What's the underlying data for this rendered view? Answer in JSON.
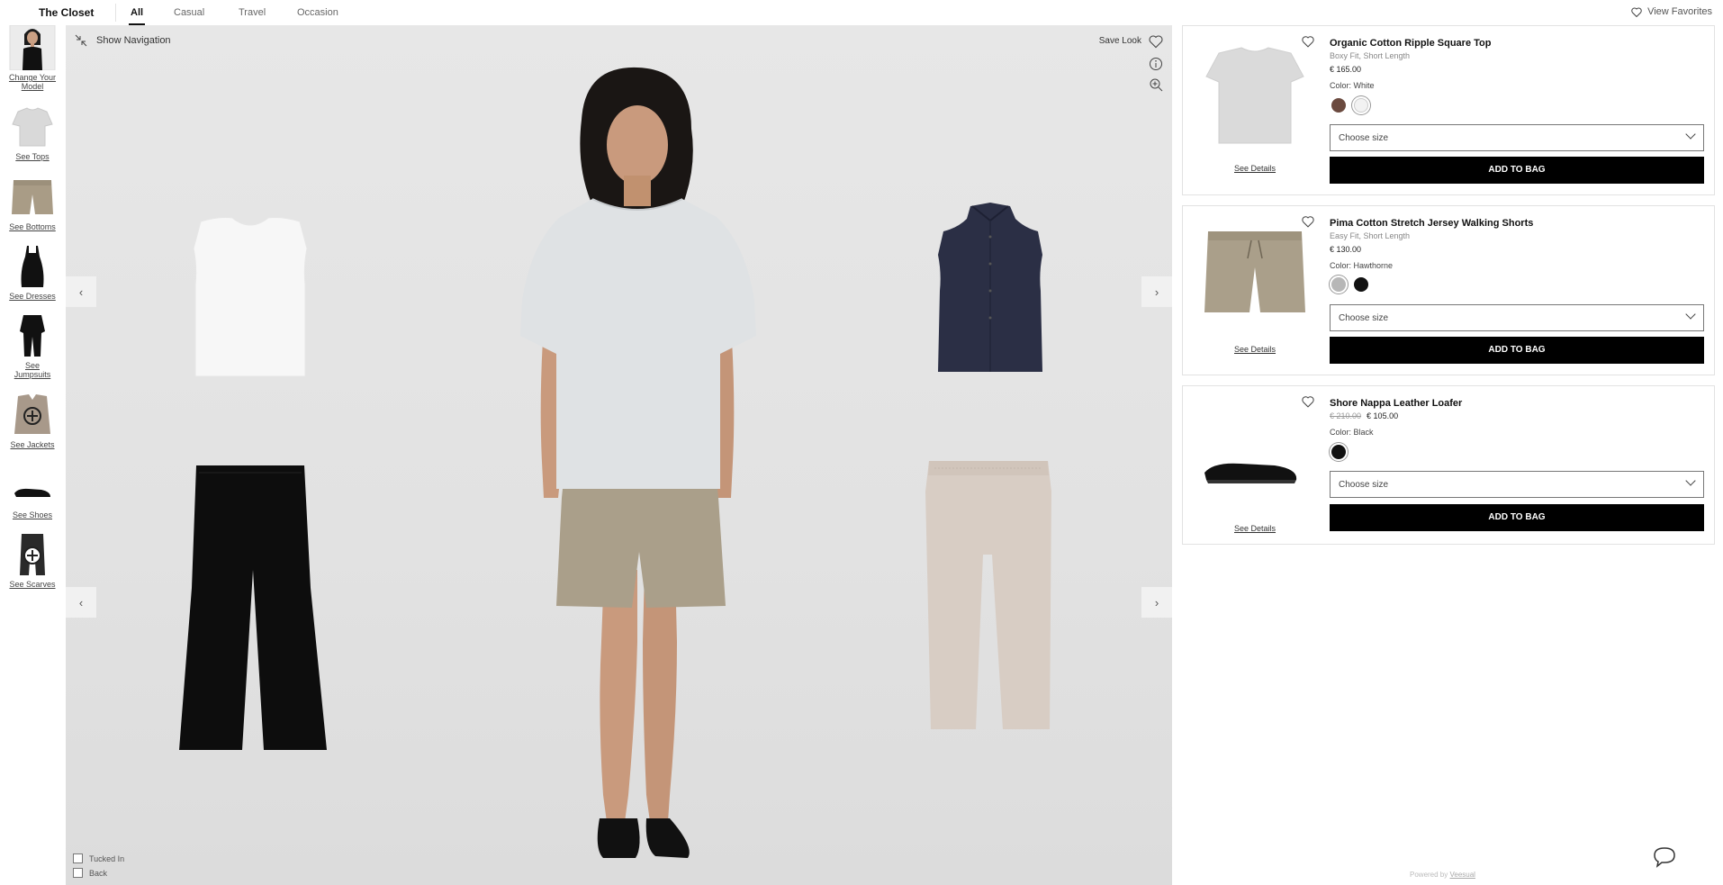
{
  "header": {
    "brand": "The Closet",
    "tabs": [
      {
        "label": "All",
        "active": true
      },
      {
        "label": "Casual",
        "active": false
      },
      {
        "label": "Travel",
        "active": false
      },
      {
        "label": "Occasion",
        "active": false
      }
    ],
    "favorites_label": "View Favorites"
  },
  "sidebar": {
    "items": [
      {
        "label": "Change Your Model",
        "icon": "model-thumbnail"
      },
      {
        "label": "See Tops",
        "icon": "top-thumbnail"
      },
      {
        "label": "See Bottoms",
        "icon": "shorts-thumbnail"
      },
      {
        "label": "See Dresses",
        "icon": "dress-thumbnail"
      },
      {
        "label": "See Jumpsuits",
        "icon": "jumpsuit-thumbnail"
      },
      {
        "label": "See Jackets",
        "icon": "jacket-thumbnail"
      },
      {
        "label": "See Shoes",
        "icon": "shoe-thumbnail"
      },
      {
        "label": "See Scarves",
        "icon": "scarf-thumbnail"
      }
    ]
  },
  "stage": {
    "show_navigation": "Show Navigation",
    "save_look": "Save Look",
    "options": [
      {
        "label": "Tucked In",
        "checked": false
      },
      {
        "label": "Back",
        "checked": false
      }
    ],
    "arrows": {
      "prev": "‹",
      "next": "›"
    }
  },
  "products": [
    {
      "name": "Organic Cotton Ripple Square Top",
      "fit": "Boxy Fit, Short Length",
      "price": "€ 165.00",
      "original_price": "",
      "color_label": "Color: White",
      "swatches": [
        "#6b4a3f",
        "#f2f2f2"
      ],
      "selected_swatch": 1,
      "size_placeholder": "Choose size",
      "add_label": "ADD TO BAG",
      "details_label": "See Details"
    },
    {
      "name": "Pima Cotton Stretch Jersey Walking Shorts",
      "fit": "Easy Fit, Short Length",
      "price": "€ 130.00",
      "original_price": "",
      "color_label": "Color: Hawthorne",
      "swatches": [
        "#b7b7b7",
        "#111111"
      ],
      "selected_swatch": 0,
      "size_placeholder": "Choose size",
      "add_label": "ADD TO BAG",
      "details_label": "See Details"
    },
    {
      "name": "Shore Nappa Leather Loafer",
      "fit": "",
      "price": "€ 105.00",
      "original_price": "€ 210.00",
      "color_label": "Color: Black",
      "swatches": [
        "#111111"
      ],
      "selected_swatch": 0,
      "size_placeholder": "Choose size",
      "add_label": "ADD TO BAG",
      "details_label": "See Details"
    }
  ],
  "footer": {
    "powered_prefix": "Powered by",
    "powered_brand": "Veesual"
  },
  "colors": {
    "accent": "#000000",
    "stage_bg": "#e4e4e4",
    "shorts": "#aa9f8a",
    "navy_top": "#2b2f45",
    "beige_pants": "#d8cdc4"
  }
}
